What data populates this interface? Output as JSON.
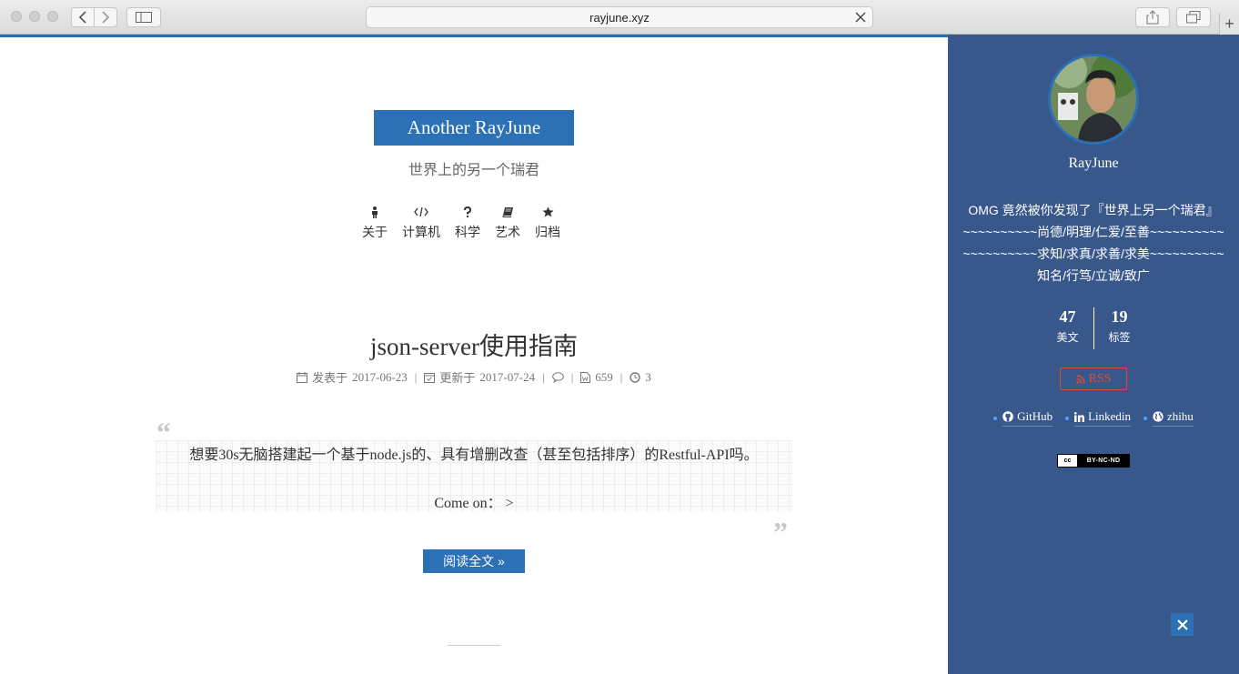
{
  "browser": {
    "url": "rayjune.xyz",
    "plus_label": "+"
  },
  "site": {
    "title": "Another RayJune",
    "subtitle": "世界上的另一个瑞君",
    "nav": [
      {
        "label": "关于",
        "icon": "person-icon"
      },
      {
        "label": "计算机",
        "icon": "code-icon"
      },
      {
        "label": "科学",
        "icon": "question-icon"
      },
      {
        "label": "艺术",
        "icon": "book-icon"
      },
      {
        "label": "归档",
        "icon": "star-icon"
      }
    ]
  },
  "post": {
    "title": "json-server使用指南",
    "meta": {
      "published_label": "发表于",
      "published_date": "2017-06-23",
      "updated_label": "更新于",
      "updated_date": "2017-07-24",
      "word_count": "659",
      "read_time": "3"
    },
    "excerpt_line1": "想要30s无脑搭建起一个基于node.js的、具有增删改查（甚至包括排序）的Restful-API吗。",
    "excerpt_line2": "Come on： >",
    "read_more_label": "阅读全文 »"
  },
  "sidebar": {
    "author": "RayJune",
    "description": [
      "OMG 竟然被你发现了『世界上另一个瑞君』",
      "~~~~~~~~~~尚德/明理/仁爱/至善~~~~~~~~~~",
      "~~~~~~~~~~求知/求真/求善/求美~~~~~~~~~~",
      "知名/行笃/立诚/致广"
    ],
    "stats": [
      {
        "count": "47",
        "label": "美文"
      },
      {
        "count": "19",
        "label": "标签"
      }
    ],
    "rss_label": "RSS",
    "social": [
      {
        "label": "GitHub",
        "icon": "github-icon"
      },
      {
        "label": "Linkedin",
        "icon": "linkedin-icon"
      },
      {
        "label": "zhihu",
        "icon": "globe-icon"
      }
    ],
    "license": {
      "logo": "cc",
      "text": "BY-NC-ND"
    }
  },
  "colors": {
    "accent": "#2c70b5",
    "sidebar_bg": "#38578a",
    "rss": "#e04b2f"
  }
}
